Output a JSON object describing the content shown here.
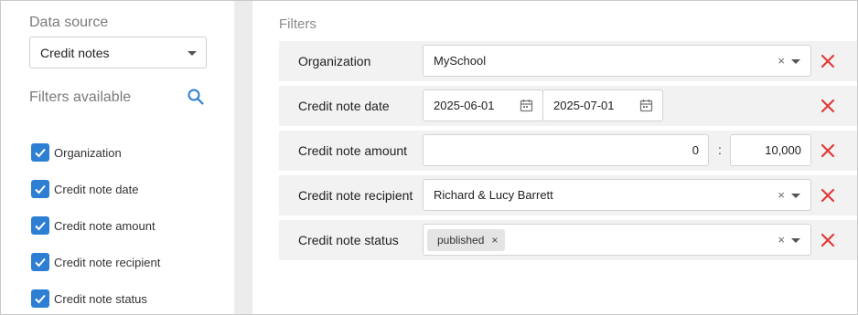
{
  "sidebar": {
    "data_source_label": "Data source",
    "data_source_value": "Credit notes",
    "filters_available_label": "Filters available",
    "items": [
      {
        "label": "Organization",
        "checked": true
      },
      {
        "label": "Credit note date",
        "checked": true
      },
      {
        "label": "Credit note amount",
        "checked": true
      },
      {
        "label": "Credit note recipient",
        "checked": true
      },
      {
        "label": "Credit note status",
        "checked": true
      }
    ]
  },
  "main": {
    "title": "Filters",
    "filters": {
      "organization": {
        "label": "Organization",
        "value": "MySchool",
        "clear": "×"
      },
      "date": {
        "label": "Credit note date",
        "from": "2025-06-01",
        "to": "2025-07-01"
      },
      "amount": {
        "label": "Credit note amount",
        "min": "0",
        "separator": ":",
        "max": "10,000"
      },
      "recipient": {
        "label": "Credit note recipient",
        "value": "Richard & Lucy Barrett",
        "clear": "×"
      },
      "status": {
        "label": "Credit note status",
        "tag": "published",
        "tag_remove": "×",
        "clear": "×"
      }
    }
  },
  "colors": {
    "accent": "#2d7fd3",
    "remove": "#e03b3b",
    "row_bg": "#f2f2f2"
  },
  "icons": [
    "search-icon",
    "check-icon",
    "calendar-icon",
    "remove-filter-icon",
    "chevron-down-icon"
  ]
}
